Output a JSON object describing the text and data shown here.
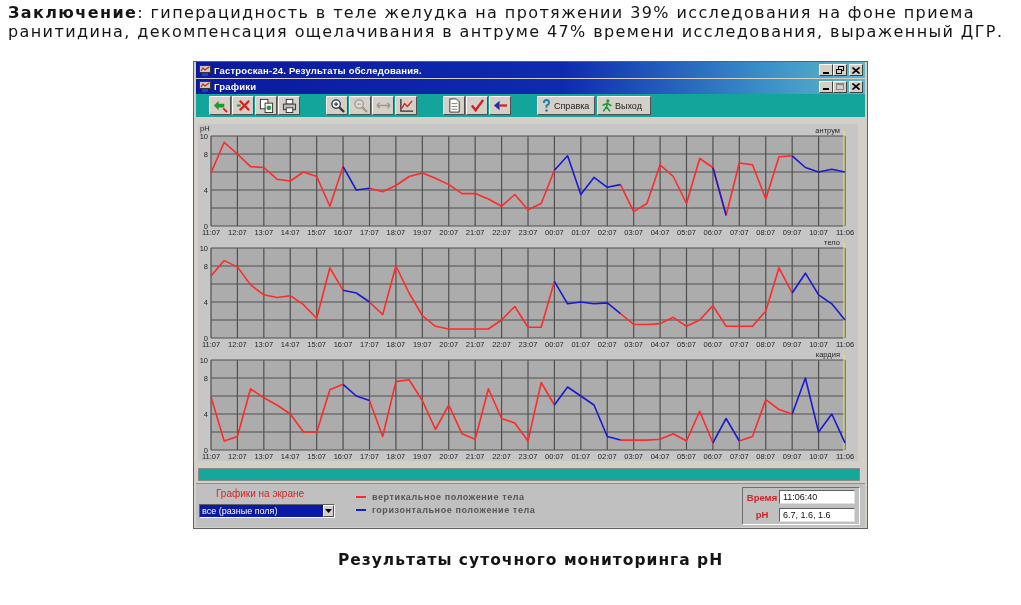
{
  "conclusion": "**Заключение**: гиперацидность в теле желудка на протяжении 39% исследования на фоне приема ранитидина, декомпенсация ощелачивания в антруме 47% времени исследования, выраженный ДГР.",
  "window": {
    "title": "Гастроскан-24. Результаты обследования.",
    "document": {
      "title": "Графики",
      "toolbar": {
        "groups": [
          [
            {
              "disabled": false
            },
            {
              "disabled": false
            },
            {
              "disabled": false
            },
            {
              "disabled": false
            }
          ],
          [
            {
              "disabled": false
            },
            {
              "disabled": true
            },
            {
              "disabled": true
            },
            {
              "disabled": false
            }
          ],
          [
            {
              "disabled": false
            },
            {
              "disabled": false
            },
            {
              "disabled": false
            }
          ]
        ],
        "buttons": [
          {
            "label": "Справка"
          },
          {
            "label": "Выход"
          }
        ]
      },
      "charts": [
        {
          "chart_data": {
            "type": "line",
            "title": "антрум",
            "ylabel": "pH",
            "grid": true,
            "categories": [
              "11:07",
              null,
              "12:07",
              null,
              "13:07",
              null,
              "14:07",
              null,
              "15:07",
              null,
              "16:07",
              null,
              "17:07",
              null,
              "18:07",
              null,
              "19:07",
              null,
              "20:07",
              null,
              "21:07",
              null,
              "22:07",
              null,
              "23:07",
              null,
              "00:07",
              null,
              "01:07",
              null,
              "02:07",
              null,
              "03:07",
              null,
              "04:07",
              null,
              "05:07",
              null,
              "06:07",
              null,
              "07:07",
              null,
              "08:07",
              null,
              "09:07",
              null,
              "10:07",
              null,
              "11:06"
            ],
            "ylim": [
              0,
              10
            ],
            "yticks": [
              0,
              4,
              8,
              10
            ],
            "series": [
              {
                "color": "#ff2a2a",
                "values": [
                  5.9,
                  9.3,
                  8.0,
                  6.6,
                  6.5,
                  5.2,
                  5.0,
                  6.0,
                  5.5,
                  2.2,
                  6.6,
                  null,
                  4.2,
                  3.8,
                  4.5,
                  5.5,
                  5.9,
                  5.3,
                  4.6,
                  3.6,
                  3.6,
                  3.0,
                  2.2,
                  3.5,
                  1.8,
                  2.5,
                  6.2,
                  null,
                  null,
                  null,
                  null,
                  4.6,
                  1.6,
                  2.5,
                  6.8,
                  5.5,
                  2.5,
                  7.5,
                  6.5,
                  1.2,
                  7.0,
                  6.8,
                  3.0,
                  7.7,
                  7.8,
                  null,
                  null,
                  null,
                  null
                ]
              },
              {
                "color": "#1a1ad0",
                "values": [
                  null,
                  null,
                  null,
                  null,
                  null,
                  null,
                  null,
                  null,
                  null,
                  null,
                  6.6,
                  4.0,
                  4.2,
                  null,
                  null,
                  null,
                  null,
                  null,
                  null,
                  null,
                  null,
                  null,
                  null,
                  null,
                  null,
                  null,
                  6.2,
                  7.8,
                  3.5,
                  5.4,
                  4.3,
                  4.6,
                  null,
                  null,
                  null,
                  null,
                  null,
                  null,
                  6.5,
                  1.2,
                  null,
                  null,
                  null,
                  null,
                  7.8,
                  6.5,
                  6.0,
                  6.3,
                  6.0
                ]
              }
            ]
          }
        },
        {
          "chart_data": {
            "type": "line",
            "title": "тело",
            "grid": true,
            "categories": [
              "11:07",
              null,
              "12:07",
              null,
              "13:07",
              null,
              "14:07",
              null,
              "15:07",
              null,
              "16:07",
              null,
              "17:07",
              null,
              "18:07",
              null,
              "19:07",
              null,
              "20:07",
              null,
              "21:07",
              null,
              "22:07",
              null,
              "23:07",
              null,
              "00:07",
              null,
              "01:07",
              null,
              "02:07",
              null,
              "03:07",
              null,
              "04:07",
              null,
              "05:07",
              null,
              "06:07",
              null,
              "07:07",
              null,
              "08:07",
              null,
              "09:07",
              null,
              "10:07",
              null,
              "11:06"
            ],
            "ylim": [
              0,
              10
            ],
            "yticks": [
              0,
              4,
              8,
              10
            ],
            "series": [
              {
                "color": "#ff2a2a",
                "values": [
                  6.9,
                  8.6,
                  7.9,
                  5.9,
                  4.8,
                  4.5,
                  4.7,
                  3.7,
                  2.2,
                  7.8,
                  5.3,
                  null,
                  4.0,
                  2.6,
                  8.0,
                  5.0,
                  2.5,
                  1.3,
                  1.0,
                  1.0,
                  1.0,
                  1.0,
                  2.0,
                  3.5,
                  1.2,
                  1.2,
                  6.3,
                  null,
                  null,
                  null,
                  null,
                  2.7,
                  1.5,
                  1.5,
                  1.6,
                  2.3,
                  1.3,
                  2.0,
                  3.6,
                  1.3,
                  1.3,
                  1.3,
                  3.0,
                  7.8,
                  5.0,
                  null,
                  null,
                  null,
                  null
                ]
              },
              {
                "color": "#1a1ad0",
                "values": [
                  null,
                  null,
                  null,
                  null,
                  null,
                  null,
                  null,
                  null,
                  null,
                  null,
                  5.3,
                  5.0,
                  4.0,
                  null,
                  null,
                  null,
                  null,
                  null,
                  null,
                  null,
                  null,
                  null,
                  null,
                  null,
                  null,
                  null,
                  6.3,
                  3.8,
                  4.0,
                  3.8,
                  3.9,
                  2.7,
                  null,
                  null,
                  null,
                  null,
                  null,
                  null,
                  null,
                  null,
                  null,
                  null,
                  null,
                  null,
                  5.0,
                  7.2,
                  4.8,
                  3.8,
                  2.0
                ]
              }
            ]
          }
        },
        {
          "chart_data": {
            "type": "line",
            "title": "кардия",
            "grid": true,
            "categories": [
              "11:07",
              null,
              "12:07",
              null,
              "13:07",
              null,
              "14:07",
              null,
              "15:07",
              null,
              "16:07",
              null,
              "17:07",
              null,
              "18:07",
              null,
              "19:07",
              null,
              "20:07",
              null,
              "21:07",
              null,
              "22:07",
              null,
              "23:07",
              null,
              "00:07",
              null,
              "01:07",
              null,
              "02:07",
              null,
              "03:07",
              null,
              "04:07",
              null,
              "05:07",
              null,
              "06:07",
              null,
              "07:07",
              null,
              "08:07",
              null,
              "09:07",
              null,
              "10:07",
              null,
              "11:06"
            ],
            "ylim": [
              0,
              10
            ],
            "yticks": [
              0,
              4,
              8,
              10
            ],
            "series": [
              {
                "color": "#ff2a2a",
                "values": [
                  5.9,
                  1.0,
                  1.5,
                  6.8,
                  5.8,
                  5.0,
                  4.0,
                  2.0,
                  2.0,
                  6.7,
                  7.3,
                  null,
                  5.5,
                  1.5,
                  7.6,
                  7.8,
                  5.5,
                  2.3,
                  5.0,
                  1.8,
                  1.2,
                  6.8,
                  3.5,
                  3.0,
                  1.0,
                  7.5,
                  5.0,
                  null,
                  null,
                  null,
                  null,
                  1.1,
                  1.1,
                  1.1,
                  1.2,
                  1.8,
                  1.0,
                  4.3,
                  0.8,
                  null,
                  1.0,
                  1.5,
                  5.6,
                  4.5,
                  4.0,
                  null,
                  null,
                  null,
                  null
                ]
              },
              {
                "color": "#1a1ad0",
                "values": [
                  null,
                  null,
                  null,
                  null,
                  null,
                  null,
                  null,
                  null,
                  null,
                  null,
                  7.3,
                  6.0,
                  5.5,
                  null,
                  null,
                  null,
                  null,
                  null,
                  null,
                  null,
                  null,
                  null,
                  null,
                  null,
                  null,
                  null,
                  5.0,
                  7.0,
                  6.0,
                  5.0,
                  1.5,
                  1.1,
                  null,
                  null,
                  null,
                  null,
                  null,
                  null,
                  0.8,
                  3.5,
                  1.0,
                  null,
                  null,
                  null,
                  4.0,
                  8.0,
                  2.0,
                  4.0,
                  0.8
                ]
              }
            ]
          }
        }
      ],
      "bottom_panel": {
        "display_label": "Графики на экране",
        "display_select": {
          "value": "все (разные поля)"
        },
        "legend": [
          {
            "label": "вертикальное положение тела",
            "color": "#ff2a2a"
          },
          {
            "label": "горизонтальное положение тела",
            "color": "#1a1ad0"
          }
        ],
        "readouts": [
          {
            "label": "Время",
            "value": "11:06:40"
          },
          {
            "label": "pH",
            "value": "6.7, 1.6, 1.6"
          }
        ]
      }
    }
  },
  "caption": "Результаты суточного мониторинга pH"
}
